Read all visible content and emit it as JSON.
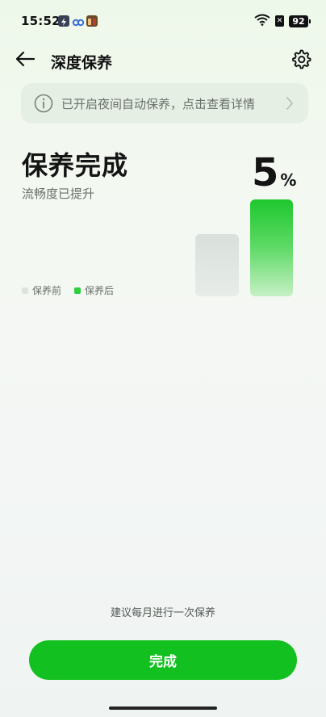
{
  "status_bar": {
    "time": "15:52",
    "battery": "92",
    "icons": [
      "app-notification-icon",
      "cloud-icon",
      "game-app-icon",
      "wifi-icon",
      "no-sim-icon",
      "battery-icon"
    ]
  },
  "header": {
    "title": "深度保养",
    "icons": [
      "back-arrow-icon",
      "gear-icon"
    ]
  },
  "banner": {
    "text": "已开启夜间自动保养，点击查看详情",
    "icons": [
      "info-icon",
      "chevron-right-icon"
    ]
  },
  "result": {
    "title": "保养完成",
    "subtitle": "流畅度已提升",
    "percent_value": "5",
    "percent_unit": "%"
  },
  "chart_data": {
    "type": "bar",
    "categories": [
      "保养前",
      "保养后"
    ],
    "values": [
      64,
      100
    ],
    "colors": [
      "#dde3df",
      "#1ec72e"
    ]
  },
  "legend": {
    "before": "保养前",
    "after": "保养后"
  },
  "footer": {
    "suggestion": "建议每月进行一次保养",
    "done_label": "完成"
  },
  "colors": {
    "accent": "#12c01f",
    "text_primary": "#141414",
    "text_secondary": "#6a6f6b"
  }
}
